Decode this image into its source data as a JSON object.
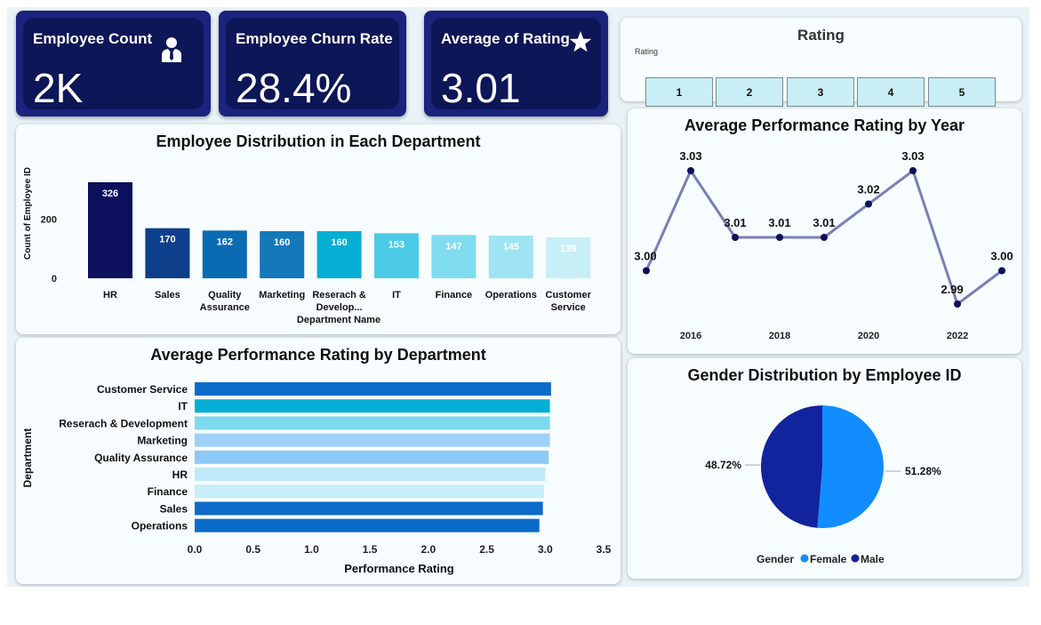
{
  "kpis": {
    "employee_count": {
      "title": "Employee Count",
      "value": "2K",
      "icon": "person-icon"
    },
    "churn_rate": {
      "title": "Employee Churn Rate",
      "value": "28.4%"
    },
    "avg_rating": {
      "title": "Average of Rating",
      "value": "3.01",
      "icon": "star-icon"
    }
  },
  "slicer": {
    "title": "Rating",
    "label": "Rating",
    "options": [
      "1",
      "2",
      "3",
      "4",
      "5"
    ]
  },
  "colors": {
    "kpi_bg": "#1a237e",
    "kpi_inner": "#0d1656",
    "line": "#7b7fb5",
    "marker": "#0d0f5a",
    "female": "#118dff",
    "male": "#12239e"
  },
  "chart_data": [
    {
      "id": "dept_distribution",
      "type": "bar",
      "title": "Employee Distribution in Each Department",
      "xlabel": "Department Name",
      "ylabel": "Count of Employee ID",
      "yticks": [
        "0",
        "200"
      ],
      "ylim": [
        0,
        340
      ],
      "categories": [
        [
          "HR"
        ],
        [
          "Sales"
        ],
        [
          "Quality",
          "Assurance"
        ],
        [
          "Marketing"
        ],
        [
          "Reserach &",
          "Develop..."
        ],
        [
          "IT"
        ],
        [
          "Finance"
        ],
        [
          "Operations"
        ],
        [
          "Customer",
          "Service"
        ]
      ],
      "values": [
        326,
        170,
        162,
        160,
        160,
        153,
        147,
        145,
        139
      ],
      "labels": [
        "326",
        "170",
        "162",
        "160",
        "160",
        "153",
        "147",
        "145",
        "139"
      ],
      "colors": [
        "#0b0f5c",
        "#0d3f8a",
        "#0a6bb3",
        "#1478bb",
        "#04aed4",
        "#4ccbe6",
        "#7fdcee",
        "#9fe4f2",
        "#c8eef7"
      ]
    },
    {
      "id": "perf_by_year",
      "type": "line",
      "title": "Average Performance Rating by Year",
      "x": [
        2015,
        2016,
        2017,
        2018,
        2019,
        2020,
        2021,
        2022,
        2023
      ],
      "values": [
        3.0,
        3.03,
        3.01,
        3.01,
        3.01,
        3.02,
        3.03,
        2.99,
        3.0
      ],
      "labels": [
        "3.00",
        "3.03",
        "3.01",
        "3.01",
        "3.01",
        "3.02",
        "3.03",
        "2.99",
        "3.00"
      ],
      "xticks": [
        "2016",
        "2018",
        "2020",
        "2022"
      ],
      "ylim": [
        2.988,
        3.034
      ]
    },
    {
      "id": "perf_by_dept",
      "type": "bar",
      "orientation": "horizontal",
      "title": "Average Performance Rating by Department",
      "xlabel": "Performance Rating",
      "ylabel": "Department",
      "categories": [
        "Customer Service",
        "IT",
        "Reserach & Development",
        "Marketing",
        "Quality Assurance",
        "HR",
        "Finance",
        "Sales",
        "Operations"
      ],
      "values": [
        3.05,
        3.04,
        3.04,
        3.04,
        3.03,
        3.0,
        2.99,
        2.98,
        2.95
      ],
      "xticks": [
        "0.0",
        "0.5",
        "1.0",
        "1.5",
        "2.0",
        "2.5",
        "3.0",
        "3.5"
      ],
      "xlim": [
        0,
        3.5
      ],
      "colors": [
        "#0a6bc9",
        "#04aed4",
        "#7fd9ee",
        "#9fd0f8",
        "#8ec8f6",
        "#bfe9f6",
        "#c8eef7",
        "#0a6bc9",
        "#0a6bc9"
      ]
    },
    {
      "id": "gender_dist",
      "type": "pie",
      "title": "Gender Distribution by Employee ID",
      "slices": [
        {
          "name": "Female",
          "value": 51.28,
          "label": "51.28%",
          "color": "#118dff"
        },
        {
          "name": "Male",
          "value": 48.72,
          "label": "48.72%",
          "color": "#12239e"
        }
      ],
      "legend_title": "Gender"
    }
  ]
}
